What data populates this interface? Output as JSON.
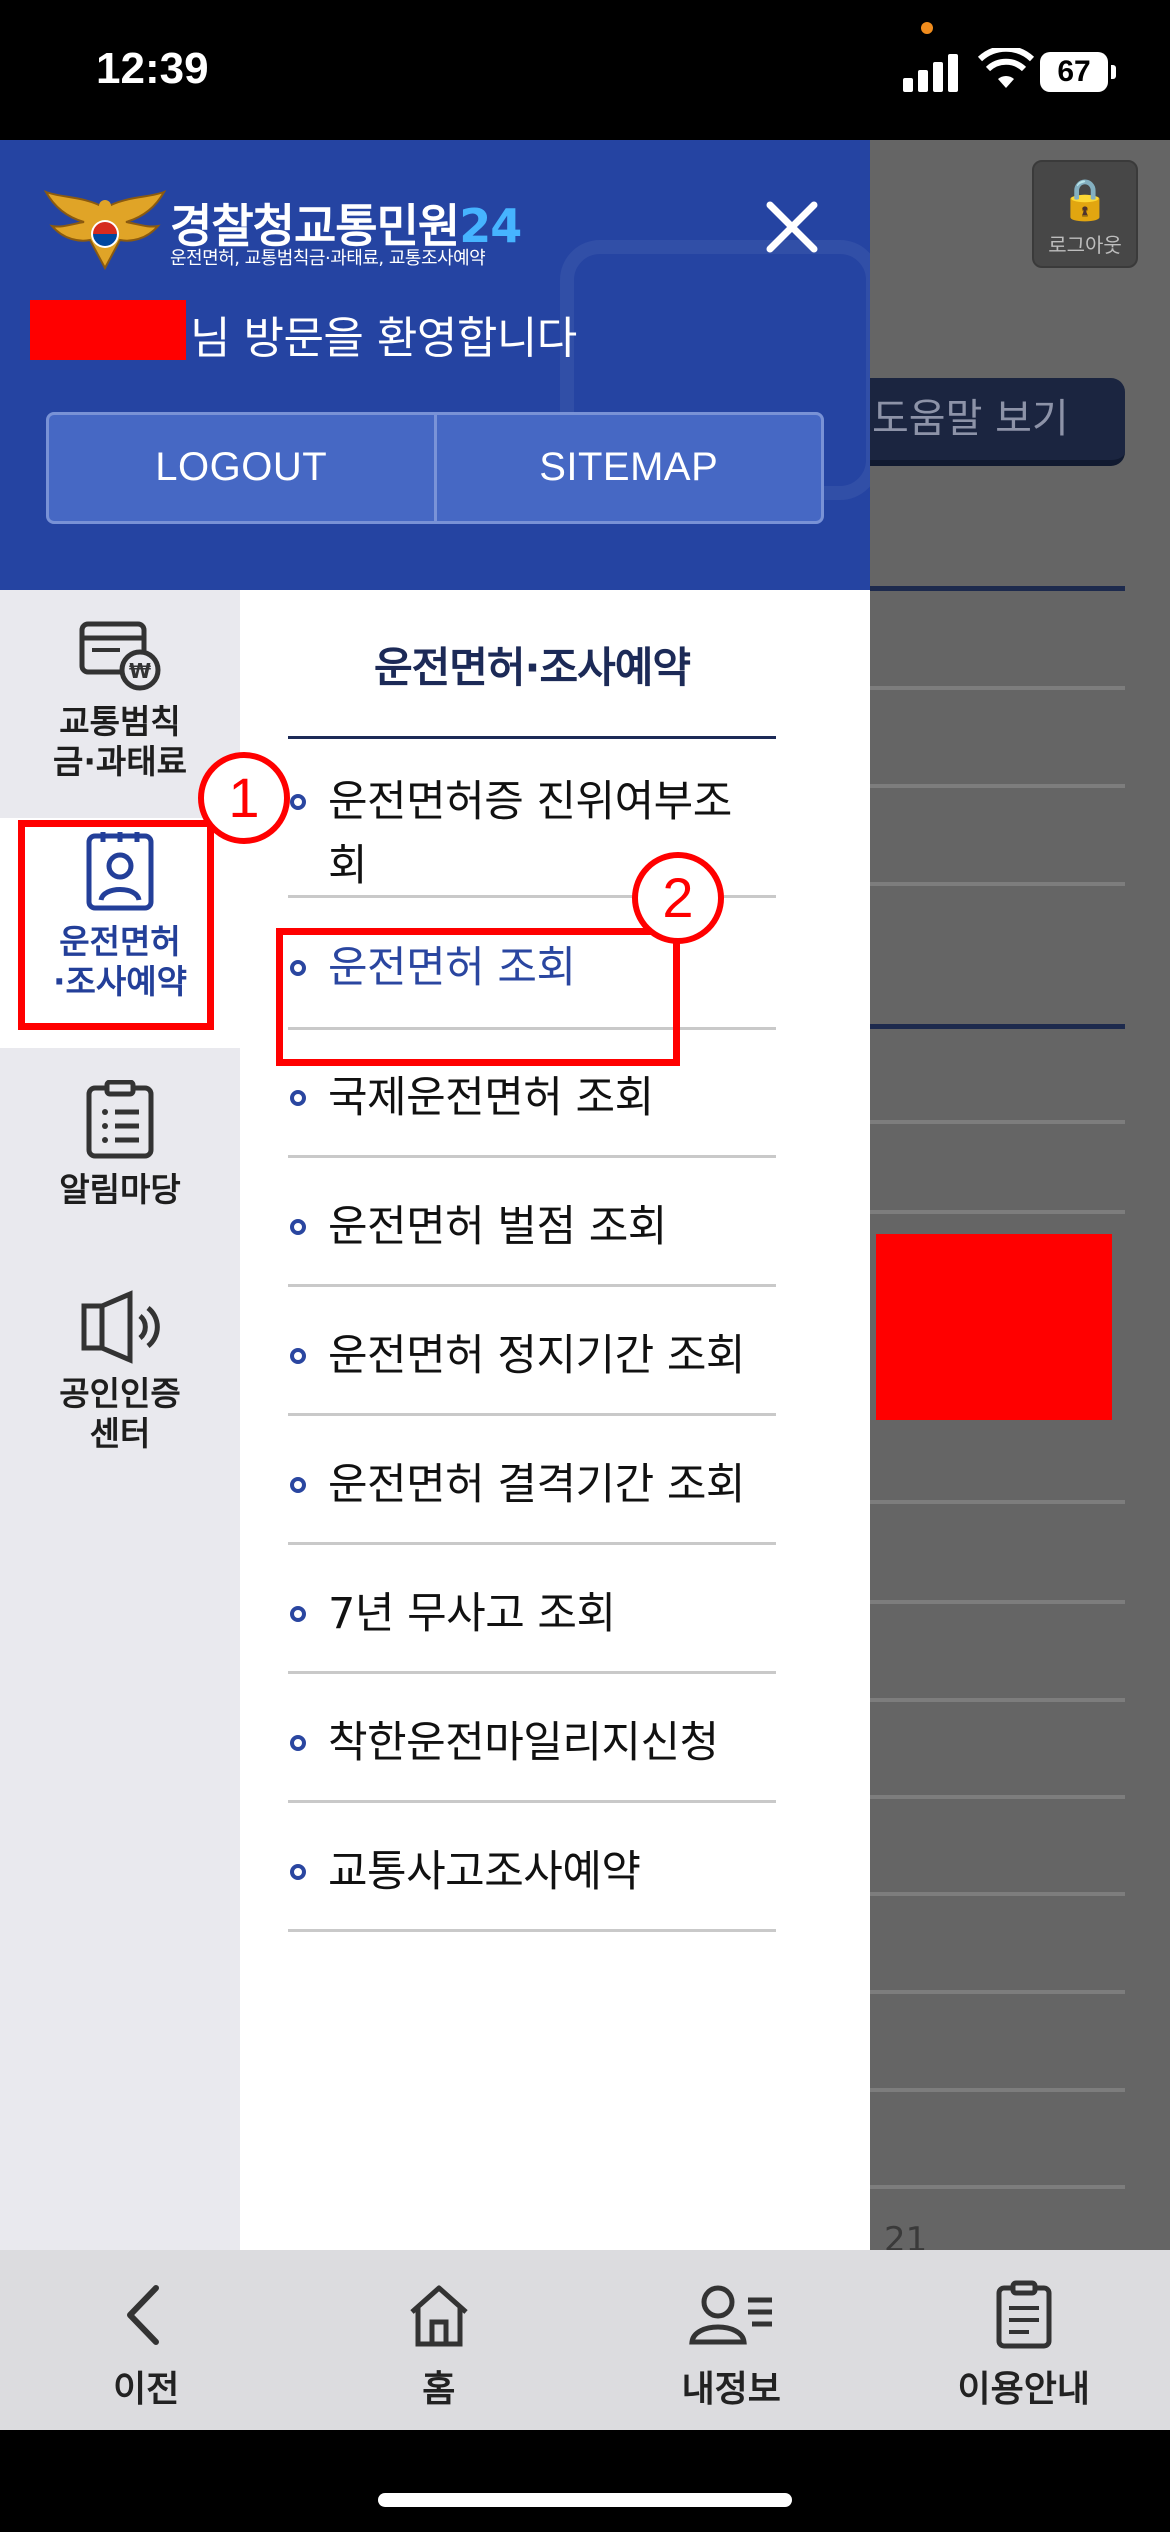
{
  "status_bar": {
    "time": "12:39",
    "battery": "67",
    "icons": [
      "signal-icon",
      "wifi-icon",
      "battery-icon"
    ]
  },
  "background_page": {
    "logout_label": "로그아웃",
    "help_label": "도움말 보기",
    "partial_text": "21"
  },
  "drawer": {
    "logo": {
      "title": "경찰청교통민원",
      "title_number": "24",
      "subtitle": "운전면허, 교통범칙금·과태료, 교통조사예약"
    },
    "welcome": "님 방문을 환영합니다",
    "buttons": {
      "logout": "LOGOUT",
      "sitemap": "SITEMAP"
    },
    "categories": [
      {
        "label_line1": "교통범칙",
        "label_line2": "금·과태료",
        "icon": "fine-card-icon"
      },
      {
        "label_line1": "운전면허",
        "label_line2": "·조사예약",
        "icon": "license-id-icon",
        "active": true
      },
      {
        "label_line1": "알림마당",
        "label_line2": "",
        "icon": "clipboard-list-icon"
      },
      {
        "label_line1": "공인인증",
        "label_line2": "센터",
        "icon": "speaker-icon"
      }
    ],
    "submenu": {
      "title": "운전면허·조사예약",
      "items": [
        {
          "line1": "운전면허증 진위여부조",
          "line2": "회"
        },
        {
          "line1": "운전면허 조회",
          "active": true
        },
        {
          "line1": "국제운전면허 조회"
        },
        {
          "line1": "운전면허 벌점 조회"
        },
        {
          "line1": "운전면허 정지기간 조회"
        },
        {
          "line1": "운전면허 결격기간 조회"
        },
        {
          "line1": "7년 무사고 조회"
        },
        {
          "line1": "착한운전마일리지신청"
        },
        {
          "line1": "교통사고조사예약"
        }
      ]
    }
  },
  "annotations": {
    "step1": "1",
    "step2": "2",
    "color": "#ff0000"
  },
  "bottom_nav": [
    {
      "label": "이전",
      "icon": "back-chevron-icon"
    },
    {
      "label": "홈",
      "icon": "home-icon"
    },
    {
      "label": "내정보",
      "icon": "user-info-icon"
    },
    {
      "label": "이용안내",
      "icon": "guide-clipboard-icon"
    }
  ],
  "colors": {
    "header_blue": "#2544a2",
    "accent_navy": "#1c2a57",
    "link_blue": "#2a46a0"
  }
}
